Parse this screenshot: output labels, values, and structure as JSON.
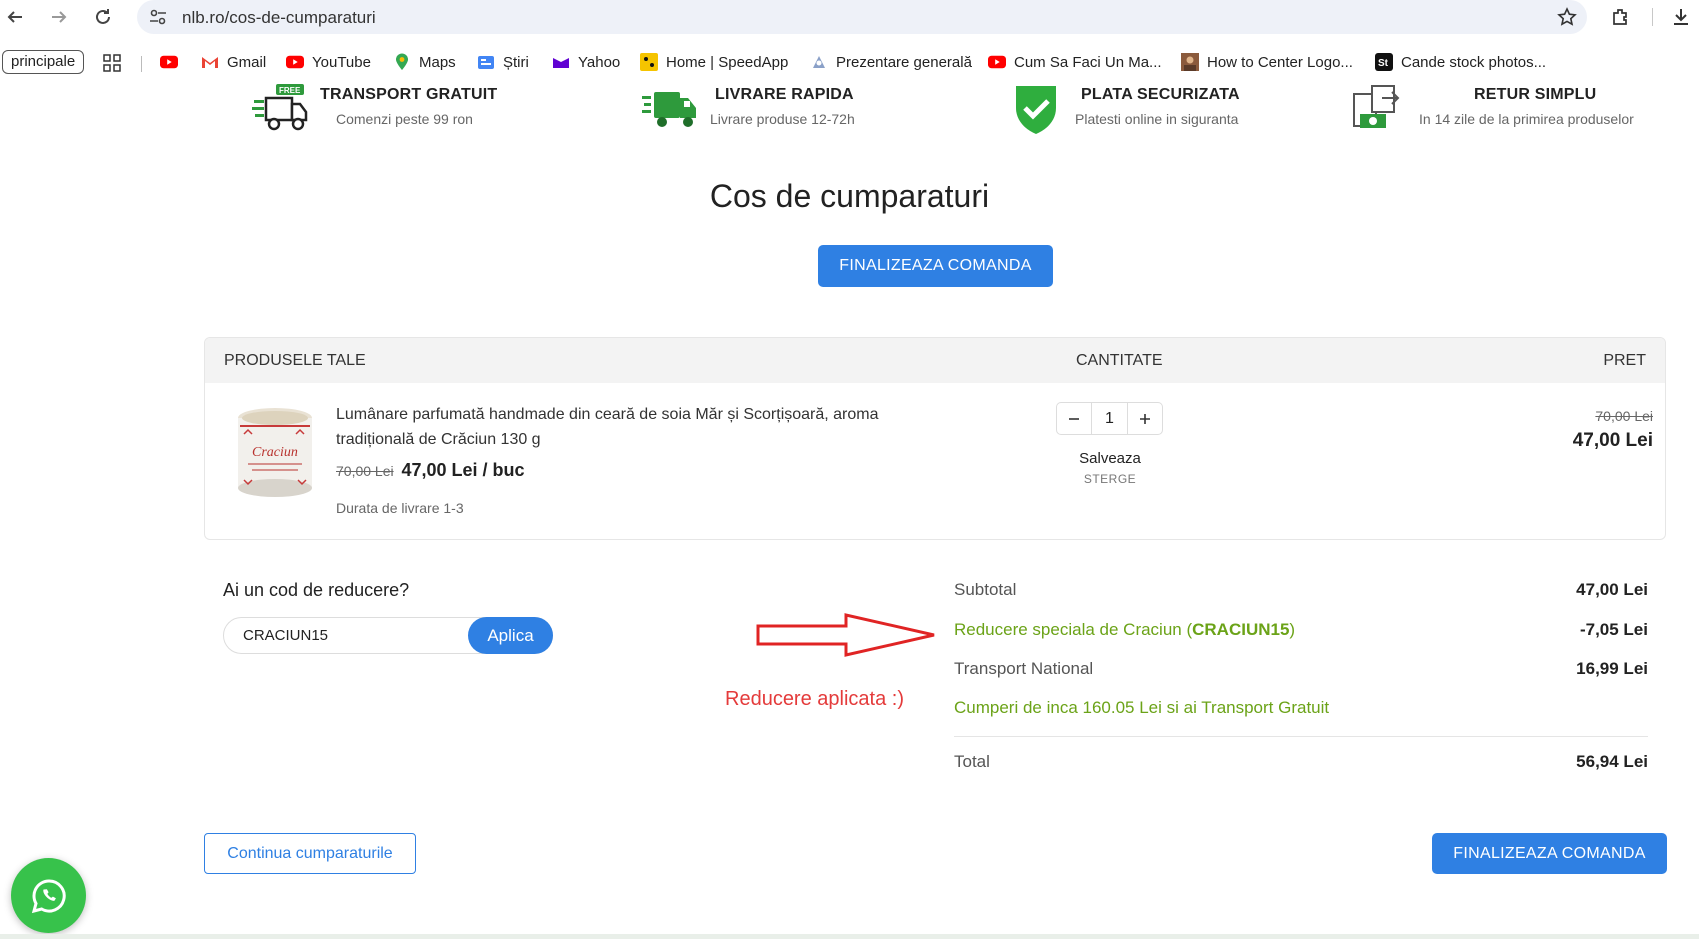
{
  "browser": {
    "url": "nlb.ro/cos-de-cumparaturi",
    "bookmarks": {
      "pill": "principale",
      "items": [
        {
          "label": "",
          "icon": "youtube-icon"
        },
        {
          "label": "Gmail",
          "icon": "gmail-icon"
        },
        {
          "label": "YouTube",
          "icon": "youtube-icon"
        },
        {
          "label": "Maps",
          "icon": "maps-icon"
        },
        {
          "label": "Știri",
          "icon": "news-icon"
        },
        {
          "label": "Yahoo",
          "icon": "yahoo-icon"
        },
        {
          "label": "Home | SpeedApp",
          "icon": "speedapp-icon"
        },
        {
          "label": "Prezentare generală",
          "icon": "overview-icon"
        },
        {
          "label": "Cum Sa Faci Un Ma...",
          "icon": "youtube-icon"
        },
        {
          "label": "How to Center Logo...",
          "icon": "photo-icon"
        },
        {
          "label": "Cande stock photos...",
          "icon": "stock-icon"
        }
      ]
    }
  },
  "benefits": [
    {
      "title": "TRANSPORT GRATUIT",
      "subtitle": "Comenzi peste 99 ron",
      "badge": "FREE"
    },
    {
      "title": "LIVRARE RAPIDA",
      "subtitle": "Livrare produse 12-72h"
    },
    {
      "title": "PLATA SECURIZATA",
      "subtitle": "Platesti online in siguranta"
    },
    {
      "title": "RETUR SIMPLU",
      "subtitle": "In 14 zile de la primirea produselor"
    }
  ],
  "cart": {
    "title": "Cos de cumparaturi",
    "checkout_label": "FINALIZEAZA COMANDA",
    "headers": {
      "products": "PRODUSELE TALE",
      "quantity": "CANTITATE",
      "price": "PRET"
    },
    "items": [
      {
        "name": "Lumânare parfumată handmade din ceară de soia Măr și Scorțișoară, aroma tradițională de Crăciun 130 g",
        "old_price": "70,00 Lei",
        "unit_price": "47,00 Lei / buc",
        "delivery": "Durata de livrare 1-3",
        "quantity": "1",
        "save_label": "Salveaza",
        "delete_label": "STERGE",
        "line_old": "70,00 Lei",
        "line_total": "47,00 Lei",
        "label_text": "Craciun"
      }
    ],
    "continue_label": "Continua cumparaturile"
  },
  "coupon": {
    "question": "Ai un cod de reducere?",
    "value": "CRACIUN15",
    "apply_label": "Aplica",
    "annotation": "Reducere aplicata :)"
  },
  "summary": {
    "subtotal_label": "Subtotal",
    "subtotal_value": "47,00 Lei",
    "discount_label_prefix": "Reducere speciala de Craciun (",
    "discount_code": "CRACIUN15",
    "discount_label_suffix": ")",
    "discount_value": "-7,05 Lei",
    "shipping_label": "Transport National",
    "shipping_value": "16,99 Lei",
    "free_shipping_note": "Cumperi de inca 160.05 Lei si ai Transport Gratuit",
    "total_label": "Total",
    "total_value": "56,94 Lei"
  },
  "colors": {
    "primary": "#2f80e3",
    "green": "#6ba318",
    "annotation_red": "#e43b3b"
  }
}
